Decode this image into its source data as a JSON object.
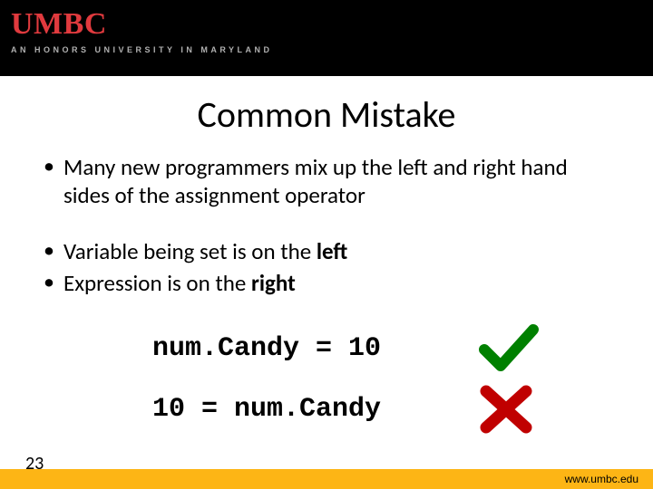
{
  "header": {
    "logo_text": "UMBC",
    "tagline": "AN HONORS UNIVERSITY IN MARYLAND"
  },
  "title": "Common Mistake",
  "bullets": [
    "Many new programmers mix up the left and right hand sides of the assignment operator",
    "Variable being set is on the left",
    "Expression is on the right"
  ],
  "bold_words": {
    "left": "left",
    "right": "right"
  },
  "code": {
    "correct": "num.Candy = 10",
    "incorrect": "10 = num.Candy"
  },
  "marks": {
    "check": "check-icon",
    "cross": "cross-icon"
  },
  "colors": {
    "check": "#008000",
    "cross": "#c00000",
    "accent": "#fdb515",
    "brand": "#e03a3e"
  },
  "footer": {
    "page": "23",
    "url": "www.umbc.edu"
  }
}
